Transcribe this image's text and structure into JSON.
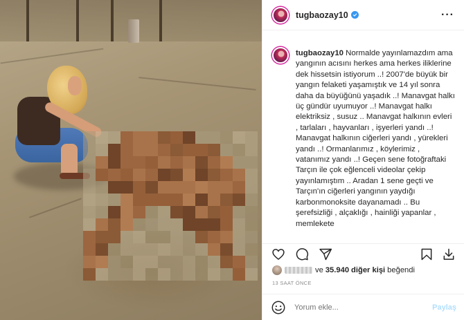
{
  "post": {
    "username": "tugbaozay10",
    "caption_user": "tugbaozay10",
    "caption_text": " Normalde yayınlamazdım ama yangının acısını herkes ama herkes iliklerine dek hissetsin istiyorum ..! 2007'de büyük bir yangın felaketi yaşamıştık ve 14 yıl sonra daha da büyüğünü yaşadık ..! Manavgat halkı üç gündür uyumuyor ..! Manavgat halkı elektriksiz , susuz .. Manavgat halkının evleri , tarlaları , hayvanları , işyerleri yandı ..! Manavgat halkının ciğerleri yandı , yürekleri yandı ..! Ormanlarımız , köylerimiz , vatanımız yandı ..! Geçen sene fotoğraftaki Tarçın ile çok eğlenceli videolar çekip yayınlamıştım .. Aradan 1 sene geçti ve Tarçın'ın ciğerleri yangının yaydığı karbonmonoksite dayanamadı .. Bu şerefsizliği , alçaklığı , hainliği yapanlar , memlekete",
    "likes_prefix": "ve",
    "likes_count": "35.940",
    "likes_suffix_bold": "diğer kişi",
    "likes_suffix": "beğendi",
    "time_ago": "13 SAAT ÖNCE"
  },
  "icons": {
    "more": "more-horizontal-icon",
    "like": "heart-icon",
    "comment": "comment-icon",
    "share": "paper-plane-icon",
    "save": "bookmark-icon",
    "download": "download-icon",
    "emoji": "emoji-icon",
    "verified": "verified-badge-icon"
  },
  "comment_box": {
    "placeholder": "Yorum ekle...",
    "post_label": "Paylaş"
  },
  "colors": {
    "verified": "#3897f0",
    "post_button": "#b2dffc",
    "muted": "#8e8e8e"
  }
}
